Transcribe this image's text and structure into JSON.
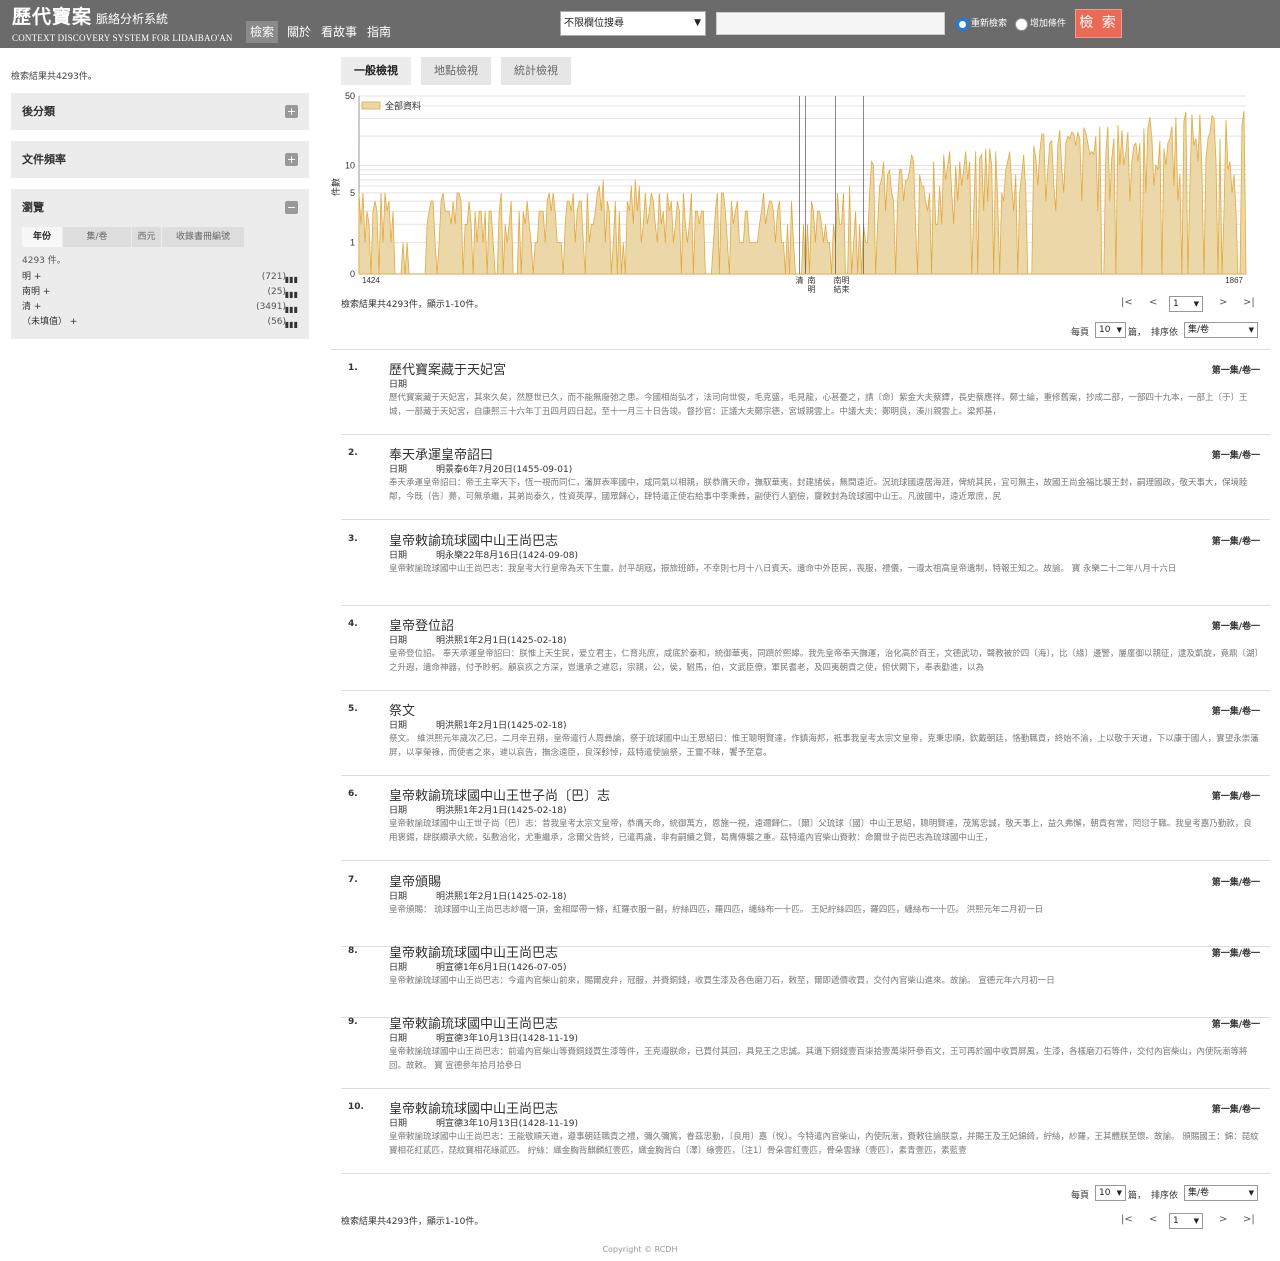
{
  "header": {
    "logo_cn": "歷代寶案",
    "logo_cn_sub": "脈絡分析系統",
    "logo_en": "CONTEXT DISCOVERY SYSTEM FOR LIDAIBAO'AN",
    "nav": [
      "檢索",
      "關於",
      "看故事",
      "指南"
    ],
    "field_select": "不限欄位搜尋",
    "search_value": "",
    "radio_new": "重新檢索",
    "radio_add": "增加條件",
    "search_button": "檢 索"
  },
  "left": {
    "summary": "檢索結果共4293件。",
    "panel_categorize": "後分類",
    "panel_frequency": "文件頻率",
    "panel_browse": "瀏覽",
    "browse_tabs": [
      "年份",
      "集/卷",
      "西元",
      "收錄書冊編號"
    ],
    "browse_count": "4293 件。",
    "browse_rows": [
      {
        "label": "明 +",
        "count": "(721)"
      },
      {
        "label": "南明 +",
        "count": "(25)"
      },
      {
        "label": "清 +",
        "count": "(3491)"
      },
      {
        "label": "（未填值） +",
        "count": "(56)"
      }
    ]
  },
  "views": [
    "一般檢視",
    "地點檢視",
    "統計檢視"
  ],
  "chart_data": {
    "type": "area",
    "series": [
      {
        "name": "全部資料"
      }
    ],
    "ylabel": "件數",
    "y_scale": "log",
    "y_ticks": [
      0,
      1,
      5,
      10,
      50
    ],
    "x_start": "1424",
    "x_end": "1867",
    "era_marks": [
      "清",
      "南明",
      "南明結束"
    ],
    "color": "#ecd7a9",
    "line_color": "#e0aa3e",
    "segments": [
      {
        "from": 1424,
        "to": 1428,
        "level": 5
      },
      {
        "from": 1428,
        "to": 1442,
        "level": 3
      },
      {
        "from": 1442,
        "to": 1446,
        "level": 0
      },
      {
        "from": 1446,
        "to": 1450,
        "level": 1
      },
      {
        "from": 1450,
        "to": 1458,
        "level": 0
      },
      {
        "from": 1458,
        "to": 1486,
        "level": 3
      },
      {
        "from": 1486,
        "to": 1494,
        "level": 2
      },
      {
        "from": 1494,
        "to": 1514,
        "level": 3
      },
      {
        "from": 1514,
        "to": 1523,
        "level": 3
      },
      {
        "from": 1523,
        "to": 1528,
        "level": 1
      },
      {
        "from": 1528,
        "to": 1539,
        "level": 3
      },
      {
        "from": 1539,
        "to": 1570,
        "level": 4
      },
      {
        "from": 1570,
        "to": 1596,
        "level": 3
      },
      {
        "from": 1596,
        "to": 1642,
        "level": 3
      },
      {
        "from": 1642,
        "to": 1646,
        "level": 0
      },
      {
        "from": 1646,
        "to": 1662,
        "level": 2
      },
      {
        "from": 1662,
        "to": 1680,
        "level": 4
      },
      {
        "from": 1680,
        "to": 1700,
        "level": 6
      },
      {
        "from": 1700,
        "to": 1735,
        "level": 8
      },
      {
        "from": 1735,
        "to": 1760,
        "level": 10
      },
      {
        "from": 1760,
        "to": 1800,
        "level": 14
      },
      {
        "from": 1800,
        "to": 1830,
        "level": 18
      },
      {
        "from": 1830,
        "to": 1867,
        "level": 20
      }
    ]
  },
  "results_summary": "檢索結果共4293件，顯示1-10件。",
  "pager": {
    "first": "|<",
    "prev": "<",
    "page": "1",
    "next": ">",
    "last": ">|"
  },
  "page_size_label": "每頁",
  "page_size": "10",
  "page_size_unit": "篇，",
  "sort_label": "排序依",
  "sort_value": "集/卷",
  "results": [
    {
      "num": "1.",
      "title": "歷代寶案藏于天妃宮",
      "vol": "第一集/卷一",
      "date_label": "日期",
      "date": "",
      "body": "歷代寶案藏于天妃宮，其來久矣，然歷世已久，而不能無廢弛之患。今國相尚弘才，法司向世俊，毛克盛，毛見龍，心甚憂之，請〔命〕紫金大夫蔡鐸，長史蔡應祥，鄭士綸，重修舊案，抄成二部，一部四十九本，一部上〔于〕王城，一部藏于天妃宮，自康熙三十六年丁丑四月四日起，至十一月三十日告竣。督抄官：正議大夫鄭宗德，宮城親雲上。中議大夫：鄭明良，湊川親雲上。梁邦基，"
    },
    {
      "num": "2.",
      "title": "奉天承運皇帝詔曰",
      "vol": "第一集/卷一",
      "date_label": "日期",
      "date": "明景泰6年7月20日(1455-09-01)",
      "body": "奉天承運皇帝詔曰：帝王主宰天下，恆一視而同仁，藩屏表率國中，咸同氣以相親，朕恭膺天命，撫馭華夷，封建諸侯，無間遠近。況琉球國遠居海涯，俾統其民，宜可無主，故國王尚金福比襲王封，嗣理國政，敬天事大，保境睦鄰，今既〔告〕薨，可無承繼，其弟尚泰久，性資英厚，國眾歸心，肆特遣正使右給事中李秉彝，副使行人劉儉，齎敕封為琉球國中山王。凡彼國中，遠近眾庶，尻"
    },
    {
      "num": "3.",
      "title": "皇帝敕諭琉球國中山王尚巴志",
      "vol": "第一集/卷一",
      "date_label": "日期",
      "date": "明永樂22年8月16日(1424-09-08)",
      "body": "皇帝敕諭琉球國中山王尚巴志：我皇考大行皇帝為天下生靈，討平胡寇，振旅班師，不幸則七月十八日賓天。遺命中外臣民，喪服，禮儀，一遵太祖高皇帝遺制，特報王知之。故諭。 寶 永樂二十二年八月十六日"
    },
    {
      "num": "4.",
      "title": "皇帝登位詔",
      "vol": "第一集/卷一",
      "date_label": "日期",
      "date": "明洪熙1年2月1日(1425-02-18)",
      "body": "皇帝登位詔。 奉天承運皇帝詔曰：朕惟上天生民，爰立君主，仁育兆庶，咸底於泰和，統御華夷，同躋於熙皞。我先皇帝奉天撫運，治化高於百王，文德武功，聲教被於四〔海〕，比〔緣〕邊警，屢廑御以親征，逮及凱旋，竟鼎〔湖〕之升遐，遺命神器，付予眇躬。顧哀疚之方深，豈遺承之遽忍，宗親，公，侯，駙馬，伯，文武臣僚，軍民耆老，及四夷朝貢之使，俯伏闕下，奉表勸進，以為"
    },
    {
      "num": "5.",
      "title": "祭文",
      "vol": "第一集/卷一",
      "date_label": "日期",
      "date": "明洪熙1年2月1日(1425-02-18)",
      "body": "祭文。 維洪熙元年歲次乙巳，二月辛丑朔，皇帝遣行人周彝論，祭于琉球國中山王思紹曰：惟王聰明賢達，作鎮海邦，祗事我皇考太宗文皇帝，克秉忠順，欽戴朝廷，恪勤職貢，終始不渝，上以敬于天道，下以康于國人，實望永崇藩屏，以享榮祿，而使者之來，遽以哀告，撫念遠臣，良深軫悼，茲特遣使諭祭，王靈不昧，饗予至意。"
    },
    {
      "num": "6.",
      "title": "皇帝敕諭琉球國中山王世子尚〔巴〕志",
      "vol": "第一集/卷一",
      "date_label": "日期",
      "date": "明洪熙1年2月1日(1425-02-18)",
      "body": "皇帝敕諭琉球國中山王世子尚〔巴〕志：昔我皇考太宗文皇帝，恭膺天命，統御萬方，恩施一視，遠邇歸仁。〔爾〕父琉球〔國〕中山王思紹，聰明賢達，茂篤忠誠，敬天事上，益久弗懈，朝貢有常，罔愆于職。我皇考嘉乃勤款，良用褒錫，肆朕纘承大統，弘敷治化，尤重繼承，念爾父告終，已遣再歲，非有嗣續之賢，曷膺傳襲之重。茲特遣內官柴山賚敕：命爾世子尚巴志為琉球國中山王，"
    },
    {
      "num": "7.",
      "title": "皇帝頒賜",
      "vol": "第一集/卷一",
      "date_label": "日期",
      "date": "明洪熙1年2月1日(1425-02-18)",
      "body": "皇帝頒賜： 琉球國中山王尚巴志紗帽一頂，金相犀帶一條，紅羅衣服一副，紵絲四匹，羅四匹，纏絲布一十匹。 王妃紵絲四匹，羅四匹，纏絲布一十匹。 洪熙元年二月初一日"
    },
    {
      "num": "8.",
      "title": "皇帝敕諭琉球國中山王尚巴志",
      "vol": "第一集/卷一",
      "date_label": "日期",
      "date": "明宣德1年6月1日(1426-07-05)",
      "body": "皇帝敕諭琉球國中山王尚巴志：今遣內官柴山前來，賜爾皮弁，冠服，并賚銅錢，收買生漆及各色磨刀石，敕至，爾即遞價收買，交付內官柴山進來。故諭。 宣德元年六月初一日"
    },
    {
      "num": "9.",
      "title": "皇帝敕諭琉球國中山王尚巴志",
      "vol": "第一集/卷一",
      "date_label": "日期",
      "date": "明宣德3年10月13日(1428-11-19)",
      "body": "皇帝敕諭琉球國中山王尚巴志：前遣內官柴山等賚銅錢買生漆等件，王克遵朕命，已買付其回，具見王之忠誠。其遺下銅錢壹百柒拾壹萬柒阡參百文，王可再於國中收買屏風，生漆，各樣磨刀石等件，交付內官柴山，內使阮漸等將回。故敕。 寶 宣德參年拾月拾參日"
    },
    {
      "num": "10.",
      "title": "皇帝敕諭琉球國中山王尚巴志",
      "vol": "第一集/卷一",
      "date_label": "日期",
      "date": "明宣德3年10月13日(1428-11-19)",
      "body": "皇帝敕諭琉球國中山王尚巴志：王能敬順天道，遵事朝廷職貢之禮，彌久彌篤，眷茲忠勤，〔良用〕嘉〔悅〕。今特遣內官柴山，內使阮漸，賚敕往諭朕意，并賜王及王妃錦綺，紵絲，紗羅，王其體朕至懷。故諭。 頒賜國王：錦：琵紋寶相花紅貳匹，琵紋寶相花綠貳匹。 紵絲：織金胸背麒麟紅壹匹，織金胸背白〔澤〕綠壹匹，〔注1〕骨朵雲紅壹匹，骨朵雲綠〔壹匹〕，素青壹匹，素藍壹"
    }
  ],
  "footer": "Copyright © RCDH"
}
